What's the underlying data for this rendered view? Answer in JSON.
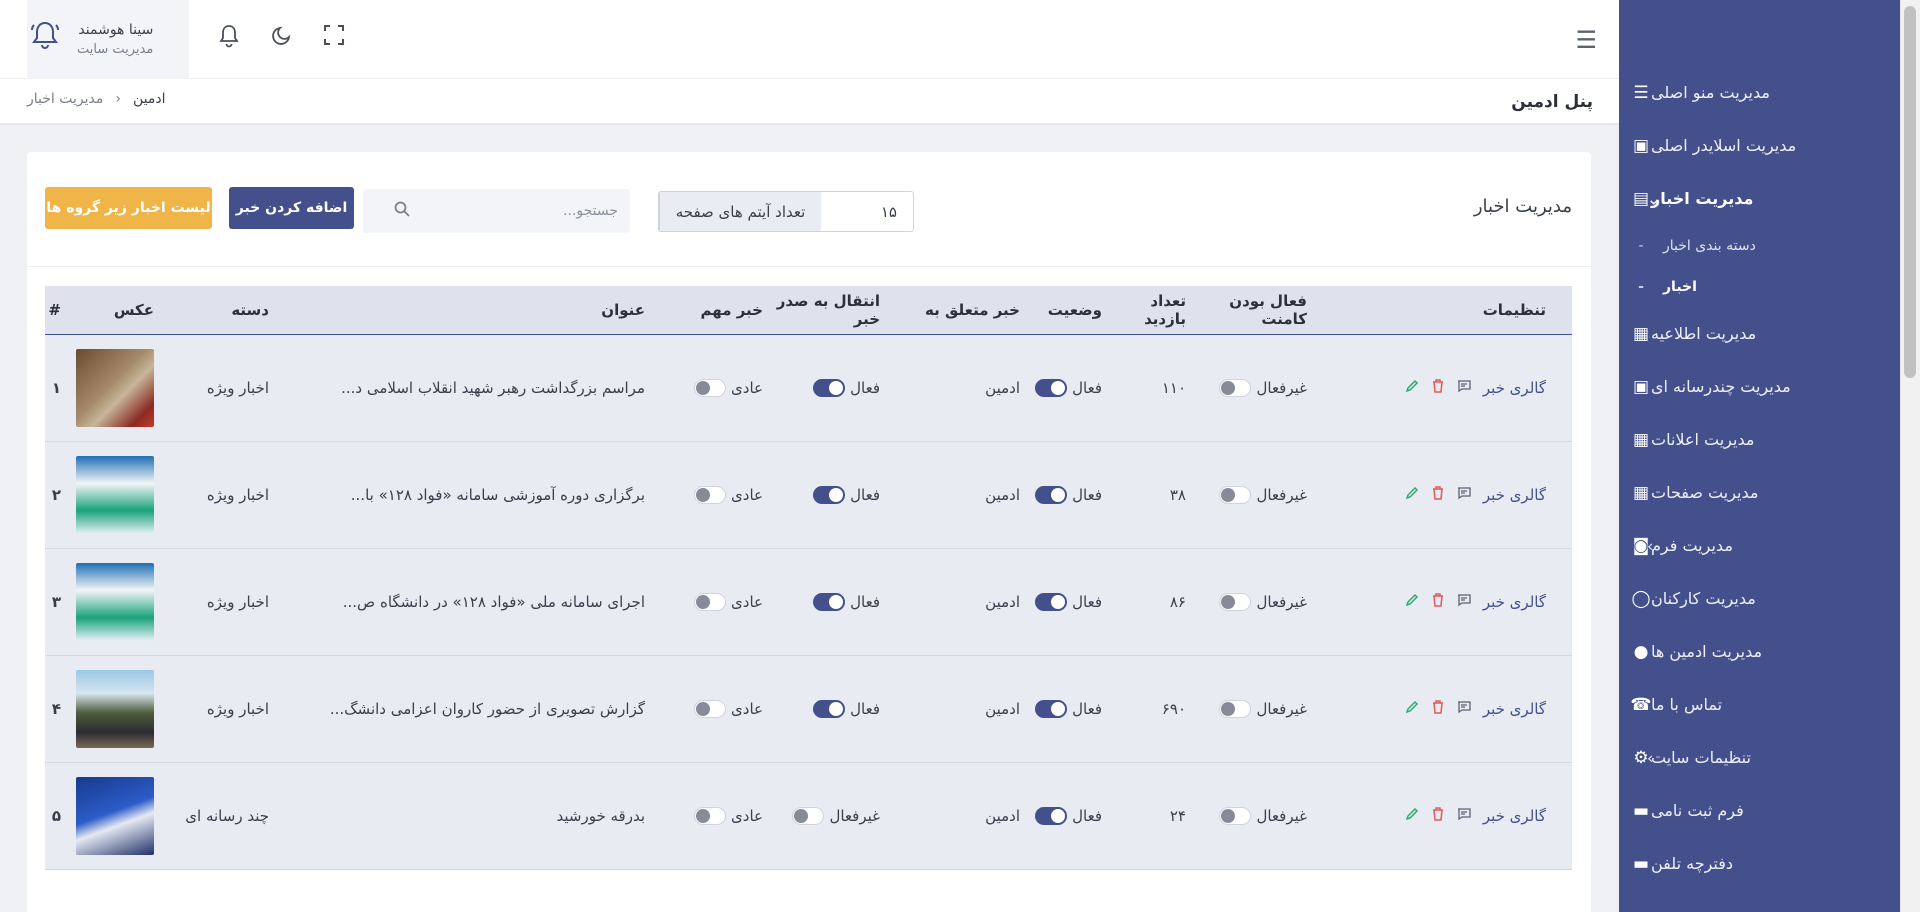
{
  "topbar": {
    "user_name": "سینا هوشمند",
    "user_role": "مدیریت سایت"
  },
  "breadcrumb": {
    "page_title": "پنل ادمین",
    "home": "ادمین",
    "current": "مدیریت اخبار"
  },
  "sidebar": {
    "items": [
      {
        "label": "مدیریت منو اصلی",
        "icon": "menu-icon"
      },
      {
        "label": "مدیریت اسلایدر اصلی",
        "icon": "image-icon"
      },
      {
        "label": "مدیریت اخبار",
        "icon": "chart-image-icon"
      },
      {
        "label": "دسته بندی اخبار"
      },
      {
        "label": "اخبار"
      },
      {
        "label": "مدیریت اطلاعیه",
        "icon": "file-icon"
      },
      {
        "label": "مدیریت چندرسانه ای",
        "icon": "image-icon"
      },
      {
        "label": "مدیریت اعلانات",
        "icon": "file-icon"
      },
      {
        "label": "مدیریت صفحات",
        "icon": "file-icon"
      },
      {
        "label": "مدیریت فرم",
        "icon": "form-icon"
      },
      {
        "label": "مدیریت کارکنان",
        "icon": "chat-icon"
      },
      {
        "label": "مدیریت ادمین ها",
        "icon": "user-icon"
      },
      {
        "label": "تماس با ما",
        "icon": "phone-icon"
      },
      {
        "label": "تنظیمات سایت",
        "icon": "gear-icon"
      },
      {
        "label": "فرم ثبت نامی",
        "icon": "book-icon"
      },
      {
        "label": "دفترچه تلفن",
        "icon": "book-icon"
      }
    ],
    "sub_dash": "-"
  },
  "card": {
    "title": "مدیریت اخبار",
    "per_page_label": "تعداد آیتم های صفحه",
    "per_page_value": "۱۵",
    "search_placeholder": "جستجو...",
    "add_button": "اضافه کردن خبر",
    "list_button": "لیست اخبار زیر گروه ها"
  },
  "table": {
    "headers": {
      "num": "#",
      "image": "عکس",
      "category": "دسته",
      "title": "عنوان",
      "important": "خبر مهم",
      "transfer": "انتقال به صدر خبر",
      "owner": "خبر متعلق به",
      "status": "وضعیت",
      "visits": "تعداد بازدید",
      "comments": "فعال بودن کامنت",
      "settings": "تنظیمات"
    },
    "gallery_label": "گالری خبر",
    "rows": [
      {
        "num": "۱",
        "category": "اخبار ویژه",
        "title": "مراسم بزرگداشت رهبر شهید انقلاب اسلامی د...",
        "important": "عادی",
        "transfer": "فعال",
        "owner": "ادمین",
        "status": "فعال",
        "visits": "۱۱۰",
        "comments": "غیرفعال"
      },
      {
        "num": "۲",
        "category": "اخبار ویژه",
        "title": "برگزاری دوره آموزشی سامانه «فواد ۱۲۸» با...",
        "important": "عادی",
        "transfer": "فعال",
        "owner": "ادمین",
        "status": "فعال",
        "visits": "۳۸",
        "comments": "غیرفعال"
      },
      {
        "num": "۳",
        "category": "اخبار ویژه",
        "title": "اجرای سامانه ملی «فواد ۱۲۸» در دانشگاه ص...",
        "important": "عادی",
        "transfer": "فعال",
        "owner": "ادمین",
        "status": "فعال",
        "visits": "۸۶",
        "comments": "غیرفعال"
      },
      {
        "num": "۴",
        "category": "اخبار ویژه",
        "title": "گزارش تصویری از حضور کاروان اعزامی دانشگ...",
        "important": "عادی",
        "transfer": "فعال",
        "owner": "ادمین",
        "status": "فعال",
        "visits": "۶۹۰",
        "comments": "غیرفعال"
      },
      {
        "num": "۵",
        "category": "چند رسانه ای",
        "title": "بدرقه خورشید",
        "important": "عادی",
        "transfer": "غیرفعال",
        "owner": "ادمین",
        "status": "فعال",
        "visits": "۲۴",
        "comments": "غیرفعال"
      }
    ]
  },
  "colors": {
    "sidebar": "#43508c",
    "primary": "#43508c",
    "warning": "#f0b548",
    "edit": "#2eaa71",
    "delete": "#e05a5a"
  }
}
